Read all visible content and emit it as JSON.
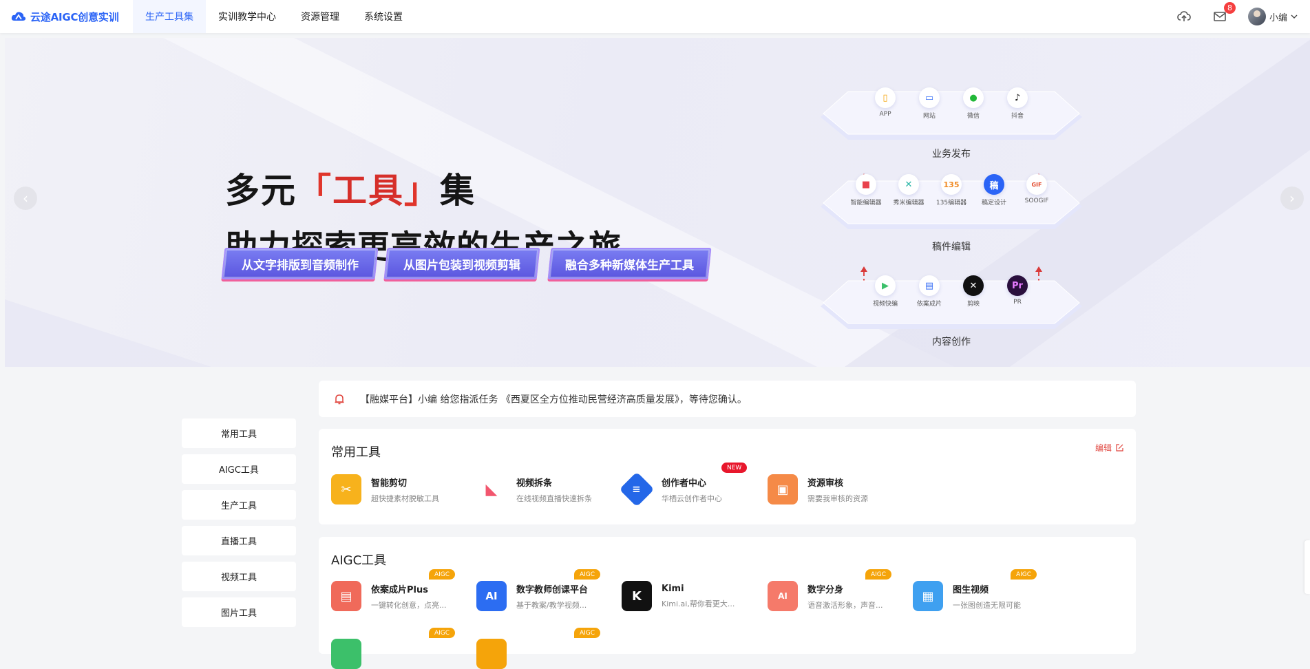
{
  "header": {
    "brand": "云途AIGC创意实训",
    "nav": [
      "生产工具集",
      "实训教学中心",
      "资源管理",
      "系统设置"
    ],
    "active_nav": 0,
    "mail_count": "8",
    "username": "小编",
    "icons": [
      "upload-icon",
      "mail-icon",
      "chevron-down-icon"
    ]
  },
  "banner": {
    "title_prefix": "多元",
    "title_highlight": "工具",
    "title_suffix": "集",
    "title_line2": "助力探索更高效的生产之旅",
    "pills": [
      "从文字排版到音频制作",
      "从图片包装到视频剪辑",
      "融合多种新媒体生产工具"
    ],
    "prev": "‹",
    "next": "›",
    "diagram": {
      "publish": {
        "items": [
          {
            "icon": "phone-icon",
            "label": "APP",
            "color": "#f5a40a"
          },
          {
            "icon": "laptop-icon",
            "label": "网站",
            "color": "#3d72f6"
          },
          {
            "icon": "wechat-icon",
            "label": "微信",
            "color": "#21b838"
          },
          {
            "icon": "douyin-icon",
            "label": "抖音",
            "color": "#111111"
          }
        ],
        "tier_label": "业务发布"
      },
      "edit": {
        "items": [
          {
            "icon": "smart-editor-icon",
            "label": "智能编辑器",
            "color": "#e8424c"
          },
          {
            "icon": "xiumi-icon",
            "label": "秀米编辑器",
            "color": "#29b5a6"
          },
          {
            "icon": "135-icon",
            "label": "135编辑器",
            "color": "#f08a24"
          },
          {
            "icon": "gaoding-icon",
            "label": "稿定设计",
            "color": "#2b64f6"
          },
          {
            "icon": "soogif-icon",
            "label": "SOOGIF",
            "color": "#e2492c"
          }
        ],
        "tier_label": "稿件编辑"
      },
      "create": {
        "items": [
          {
            "icon": "video-quick-icon",
            "label": "视频快编",
            "color": "#3cc06a"
          },
          {
            "icon": "yian-icon",
            "label": "依案成片",
            "color": "#3d72f6"
          },
          {
            "icon": "capcut-icon",
            "label": "剪映",
            "color": "#111111"
          },
          {
            "icon": "pr-icon",
            "label": "PR",
            "color": "#2a0f3d"
          }
        ],
        "tier_label": "内容创作"
      }
    }
  },
  "notice": {
    "text": "【融媒平台】小编 给您指派任务 《西夏区全方位推动民营经济高质量发展》，等待您确认。"
  },
  "sidebar": [
    "常用工具",
    "AIGC工具",
    "生产工具",
    "直播工具",
    "视频工具",
    "图片工具"
  ],
  "common_tools": {
    "title": "常用工具",
    "edit_label": "编辑",
    "items": [
      {
        "name": "智能剪切",
        "desc": "超快捷素材脱敏工具",
        "color": "#f7b21c",
        "icon": "scissors-icon"
      },
      {
        "name": "视频拆条",
        "desc": "在线视频直播快速拆条",
        "color": "#f2566e",
        "icon": "video-split-icon"
      },
      {
        "name": "创作者中心",
        "desc": "华栖云创作者中心",
        "color": "#2467e8",
        "icon": "creator-center-icon",
        "tag": "NEW"
      },
      {
        "name": "资源审核",
        "desc": "需要我审核的资源",
        "color": "#f58a47",
        "icon": "resource-review-icon"
      }
    ]
  },
  "aigc_tools": {
    "title": "AIGC工具",
    "items": [
      {
        "name": "依案成片Plus",
        "desc": "一键转化创意，点亮...",
        "color": "#f06a5a",
        "icon": "yian-plus-icon",
        "tag": "AIGC"
      },
      {
        "name": "数字教师创课平台",
        "desc": "基于教案/教学视频...",
        "color": "#2c6df2",
        "icon": "ai-teacher-icon",
        "tag": "AIGC"
      },
      {
        "name": "Kimi",
        "desc": "Kimi.ai,帮你看更大...",
        "color": "#111111",
        "icon": "kimi-icon"
      },
      {
        "name": "数字分身",
        "desc": "语音激活形象，声音...",
        "color": "#f57a6a",
        "icon": "digital-avatar-icon",
        "tag": "AIGC"
      },
      {
        "name": "图生视频",
        "desc": "一张图创造无限可能",
        "color": "#3fa0f0",
        "icon": "image-to-video-icon",
        "tag": "AIGC"
      }
    ],
    "row2_tags": [
      "AIGC",
      "AIGC"
    ]
  }
}
